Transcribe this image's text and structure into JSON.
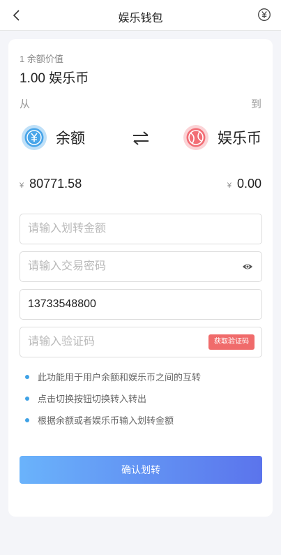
{
  "header": {
    "title": "娱乐钱包",
    "back_icon": "chevron-left-icon",
    "right_icon": "yen-circle-icon"
  },
  "rate": {
    "label": "1 余额价值",
    "value": "1.00 娱乐币"
  },
  "direction": {
    "from_label": "从",
    "to_label": "到"
  },
  "source": {
    "name": "余额",
    "icon": "yen-coin-icon",
    "color": "#48a5e9"
  },
  "target": {
    "name": "娱乐币",
    "icon": "ball-icon",
    "color": "#f26d75"
  },
  "swap_icon": "swap-arrows-icon",
  "balances": {
    "currency": "¥",
    "source_amount": "80771.58",
    "target_amount": "0.00"
  },
  "form": {
    "amount_placeholder": "请输入划转金额",
    "password_placeholder": "请输入交易密码",
    "phone_value": "13733548800",
    "code_placeholder": "请输入验证码",
    "get_code_label": "获取验证码"
  },
  "tips": [
    "此功能用于用户余额和娱乐币之间的互转",
    "点击切换按钮切换转入转出",
    "根据余额或者娱乐币输入划转金额"
  ],
  "confirm_label": "确认划转",
  "colors": {
    "accent_start": "#6ab3fb",
    "accent_end": "#5b74ec",
    "code_button": "#f06b6b",
    "bullet": "#3fa2e6"
  }
}
